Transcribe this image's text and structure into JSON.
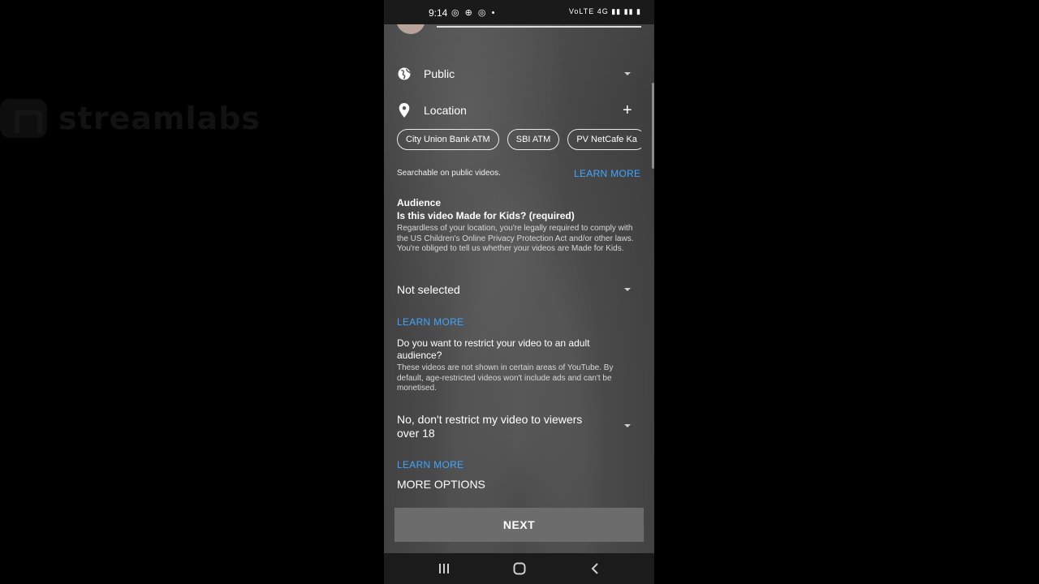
{
  "watermark": {
    "text": "streamlabs"
  },
  "status_bar": {
    "time": "9:14",
    "left_icons": "◎ ⊕ ◎ •",
    "right_icons": "VoLTE 4G ▮▮ ▮▮ ▮"
  },
  "visibility": {
    "label": "Public",
    "icon": "globe-icon"
  },
  "location": {
    "label": "Location",
    "icon": "location-pin-icon",
    "add_icon": "plus-icon",
    "suggestions": [
      "City Union Bank ATM",
      "SBI ATM",
      "PV NetCafe Ka"
    ],
    "note": "Searchable on public videos.",
    "learn_more": "LEARN MORE"
  },
  "audience": {
    "heading": "Audience",
    "question": "Is this video Made for Kids? (required)",
    "description": "Regardless of your location, you're legally required to comply with the US Children's Online Privacy Protection Act and/or other laws. You're obliged to tell us whether your videos are Made for Kids.",
    "select_value": "Not selected",
    "learn_more": "LEARN MORE"
  },
  "age_restriction": {
    "question": "Do you want to restrict your video to an adult audience?",
    "description": "These videos are not shown in certain areas of YouTube. By default, age-restricted videos won't include ads and can't be monetised.",
    "select_value": "No, don't restrict my video to viewers over 18",
    "learn_more": "LEARN MORE"
  },
  "more_options": "MORE OPTIONS",
  "next_button": "NEXT",
  "nav": {
    "recents": "recents-icon",
    "home": "home-icon",
    "back": "back-icon"
  }
}
